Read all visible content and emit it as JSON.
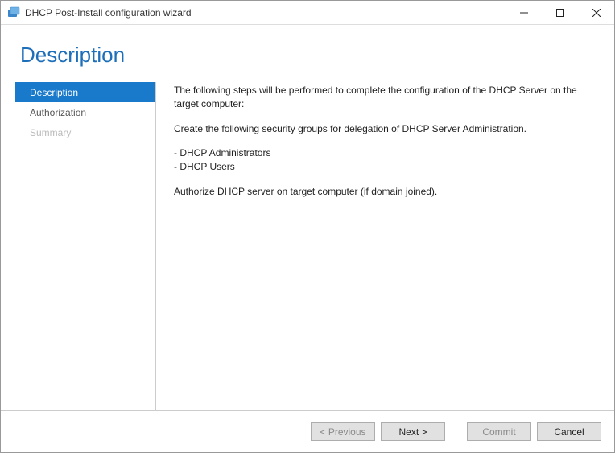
{
  "window": {
    "title": "DHCP Post-Install configuration wizard"
  },
  "heading": "Description",
  "sidebar": {
    "items": [
      {
        "label": "Description",
        "state": "active"
      },
      {
        "label": "Authorization",
        "state": "enabled"
      },
      {
        "label": "Summary",
        "state": "disabled"
      }
    ]
  },
  "main": {
    "intro": "The following steps will be performed to complete the configuration of the DHCP Server on the target computer:",
    "groups_intro": "Create the following security groups for delegation of DHCP Server Administration.",
    "group1": "- DHCP Administrators",
    "group2": "- DHCP Users",
    "authorize": "Authorize DHCP server on target computer (if domain joined)."
  },
  "footer": {
    "previous": "< Previous",
    "next": "Next >",
    "commit": "Commit",
    "cancel": "Cancel"
  }
}
